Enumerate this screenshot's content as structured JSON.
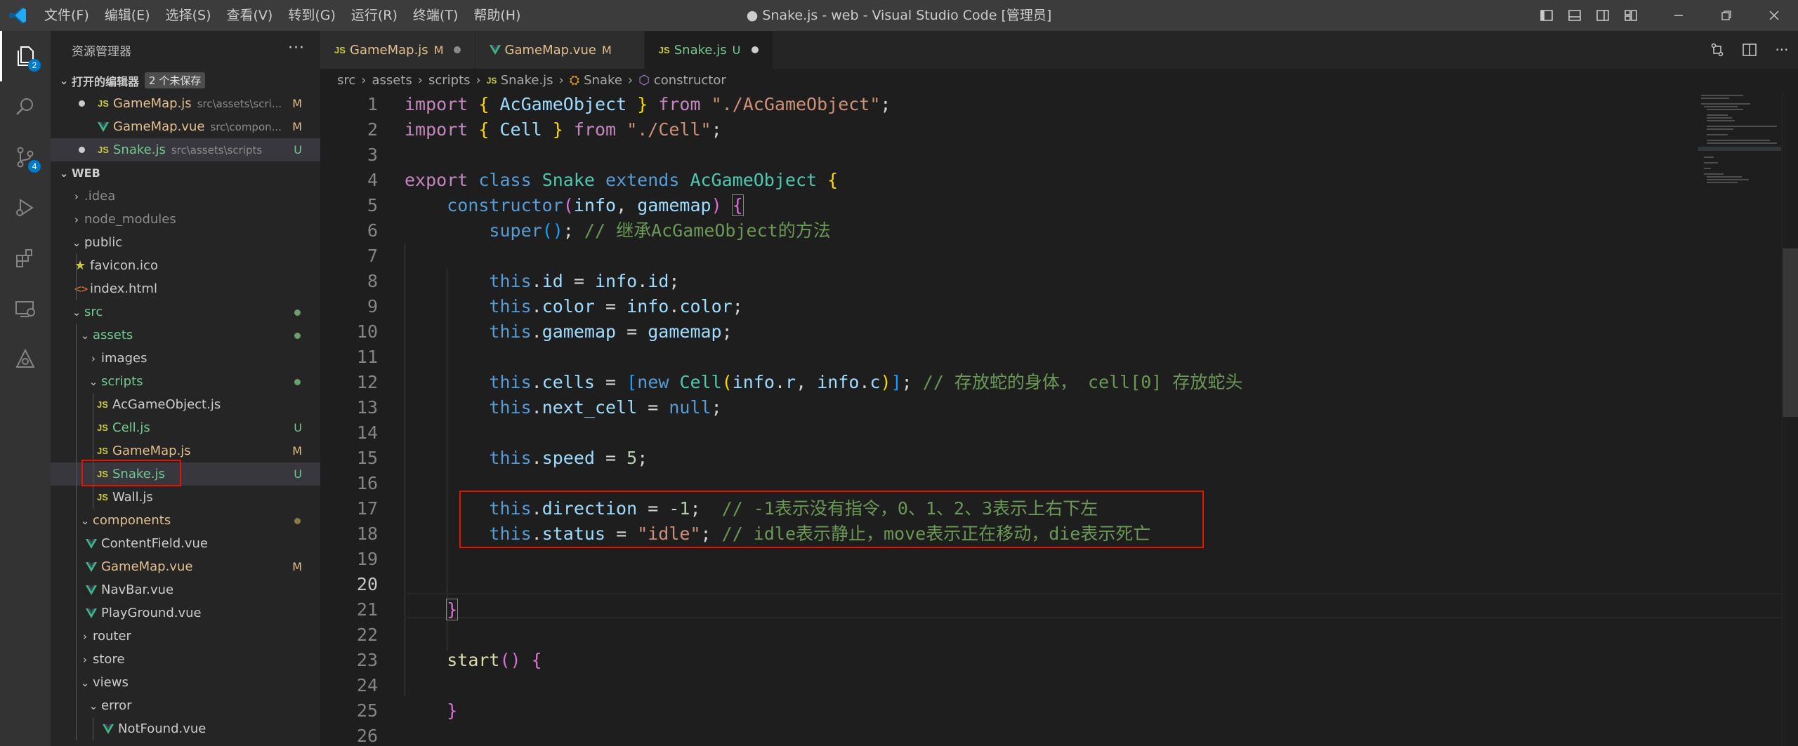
{
  "titlebar": {
    "menu": [
      "文件(F)",
      "编辑(E)",
      "选择(S)",
      "查看(V)",
      "转到(G)",
      "运行(R)",
      "终端(T)",
      "帮助(H)"
    ],
    "window_title": "● Snake.js - web - Visual Studio Code [管理员]"
  },
  "activity": {
    "explorer_badge": "2",
    "scm_badge": "4"
  },
  "sidebar": {
    "header": "资源管理器",
    "more": "···",
    "open_editors": {
      "title": "打开的编辑器",
      "badge": "2 个未保存",
      "items": [
        {
          "name": "GameMap.js",
          "path": "src\\assets\\scri...",
          "status": "M"
        },
        {
          "name": "GameMap.vue",
          "path": "src\\compon...",
          "status": "M"
        },
        {
          "name": "Snake.js",
          "path": "src\\assets\\scripts",
          "status": "U"
        }
      ]
    },
    "workspace": {
      "title": "WEB",
      "tree": [
        ".idea",
        "node_modules",
        "public",
        "favicon.ico",
        "index.html",
        "src",
        "assets",
        "images",
        "scripts",
        "AcGameObject.js",
        "Cell.js",
        "GameMap.js",
        "Snake.js",
        "Wall.js",
        "components",
        "ContentField.vue",
        "GameMap.vue",
        "NavBar.vue",
        "PlayGround.vue",
        "router",
        "store",
        "views",
        "error",
        "NotFound.vue"
      ],
      "statuses": {
        "cell": "U",
        "gamemap_js": "M",
        "snake": "U",
        "gamemap_vue": "M"
      }
    }
  },
  "tabs": [
    {
      "name": "GameMap.js",
      "status": "M"
    },
    {
      "name": "GameMap.vue",
      "status": "M"
    },
    {
      "name": "Snake.js",
      "status": "U"
    }
  ],
  "breadcrumb": [
    "src",
    "assets",
    "scripts",
    "Snake.js",
    "Snake",
    "constructor"
  ],
  "code": {
    "line_numbers": [
      "1",
      "2",
      "3",
      "4",
      "5",
      "6",
      "7",
      "8",
      "9",
      "10",
      "11",
      "12",
      "13",
      "14",
      "15",
      "16",
      "17",
      "18",
      "19",
      "20",
      "21",
      "22",
      "23",
      "24",
      "25",
      "26"
    ],
    "current_line": 20
  },
  "colors": {
    "accent": "#007acc",
    "highlight_box": "#e51400",
    "modified": "#e2c08d",
    "untracked": "#73c991"
  }
}
